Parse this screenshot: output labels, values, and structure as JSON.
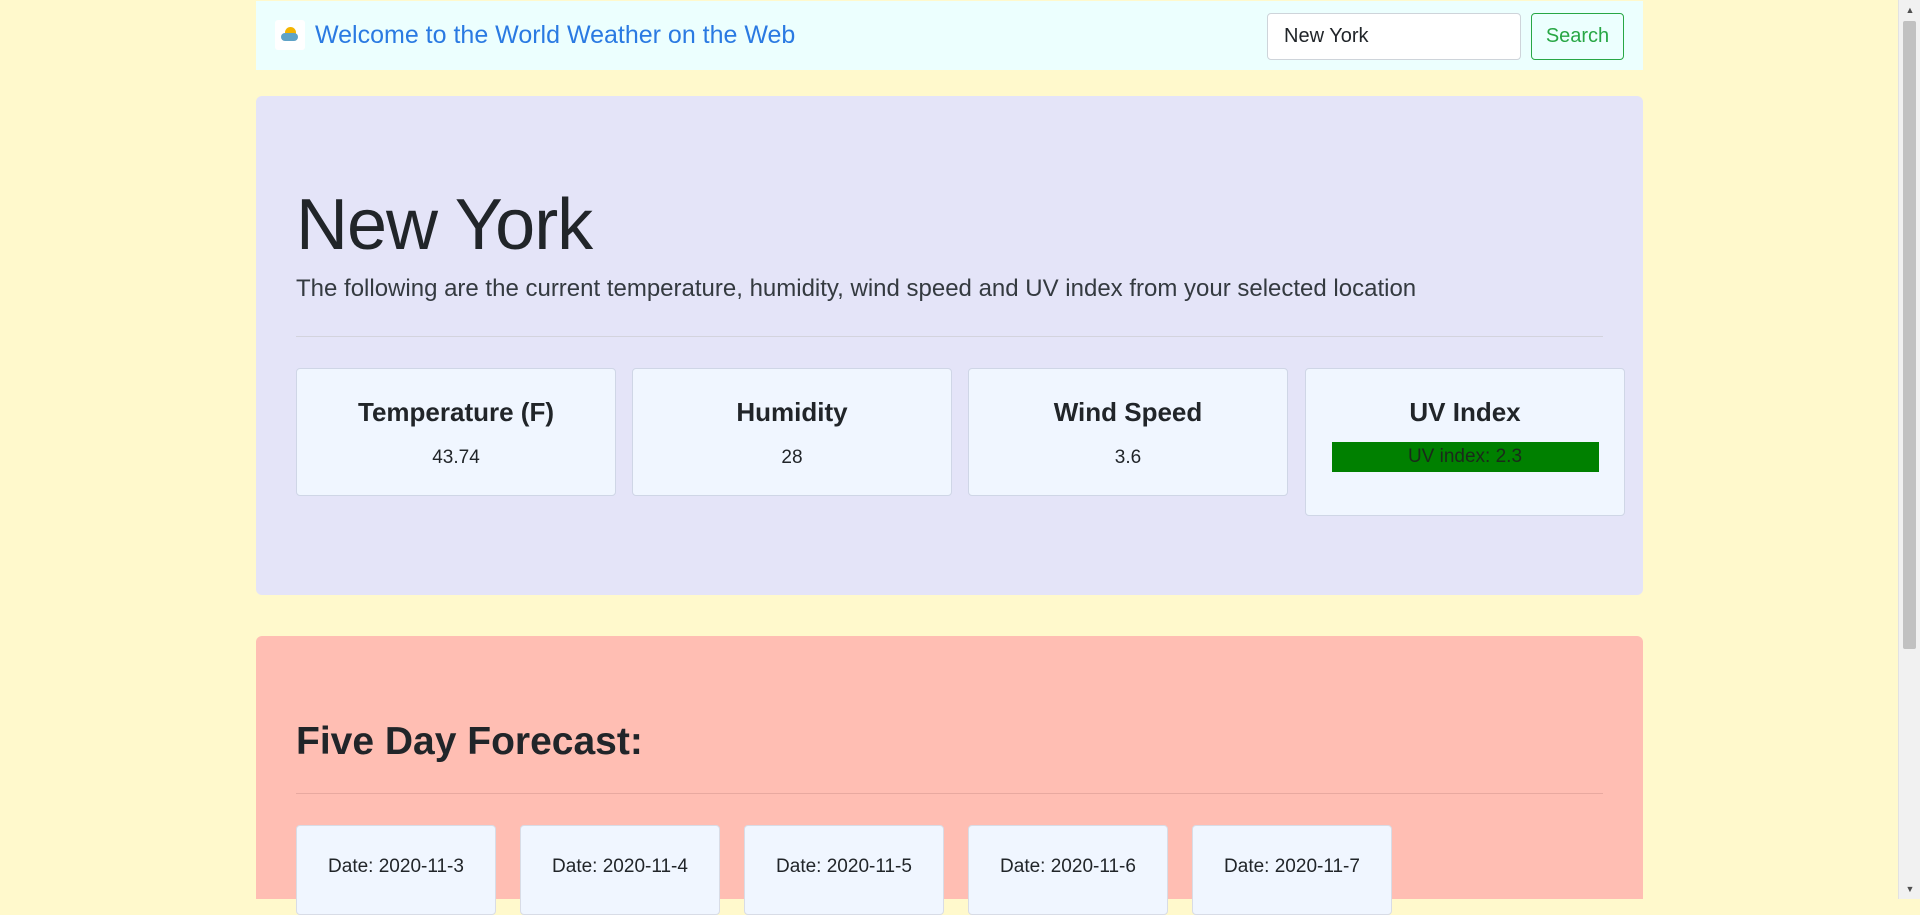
{
  "navbar": {
    "brand_icon": "sun-behind-cloud-icon",
    "title": "Welcome to the World Weather on the Web",
    "search_value": "New York",
    "search_button": "Search"
  },
  "current": {
    "city": "New York",
    "lead": "The following are the current temperature, humidity, wind speed and UV index from your selected location",
    "temperature": {
      "label": "Temperature (F)",
      "value": "43.74"
    },
    "humidity": {
      "label": "Humidity",
      "value": "28"
    },
    "wind": {
      "label": "Wind Speed",
      "value": "3.6"
    },
    "uv": {
      "label": "UV Index",
      "value": "UV index: 2.3",
      "color": "#008000"
    }
  },
  "forecast": {
    "title": "Five Day Forecast:",
    "days": [
      {
        "date": "Date: 2020-11-3"
      },
      {
        "date": "Date: 2020-11-4"
      },
      {
        "date": "Date: 2020-11-5"
      },
      {
        "date": "Date: 2020-11-6"
      },
      {
        "date": "Date: 2020-11-7"
      }
    ]
  },
  "colors": {
    "page_bg": "#fff9cc",
    "navbar_bg": "#ecfffe",
    "current_bg": "#e4e4f8",
    "forecast_bg": "#ffbeb3",
    "brand_link": "#2a7ae2",
    "search_button": "#28a745"
  }
}
